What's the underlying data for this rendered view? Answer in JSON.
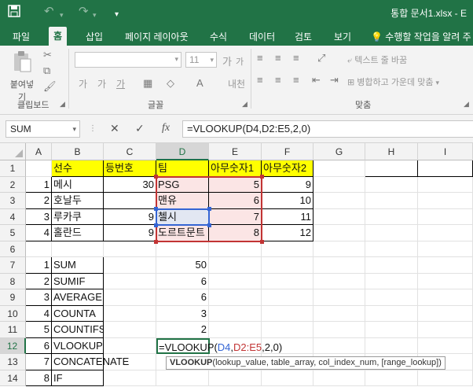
{
  "titlebar": {
    "save_icon": "save-icon",
    "undo_icon": "undo-icon",
    "redo_icon": "redo-icon",
    "qat_more_icon": "chevron-down-icon",
    "title": "통합 문서1.xlsx - E"
  },
  "tabs": [
    "파일",
    "홈",
    "삽입",
    "페이지 레이아웃",
    "수식",
    "데이터",
    "검토",
    "보기"
  ],
  "active_tab": "홈",
  "tell_me": "수행할 작업을 알려 주",
  "ribbon": {
    "clipboard": {
      "paste_label": "붙여넣기",
      "group_label": "클립보드"
    },
    "font": {
      "size_value": "11",
      "grow": "가",
      "shrink": "가",
      "group_label": "글꼴"
    },
    "alignment": {
      "wrap_text": "텍스트 줄 바꿈",
      "merge_center": "병합하고 가운데 맞춤",
      "group_label": "맞춤"
    }
  },
  "formula_bar": {
    "name_box": "SUM",
    "cancel_icon": "✕",
    "enter_icon": "✓",
    "fx_label": "fx",
    "formula": "=VLOOKUP(D4,D2:E5,2,0)"
  },
  "columns": [
    "A",
    "B",
    "C",
    "D",
    "E",
    "F",
    "G",
    "H",
    "I"
  ],
  "rows": [
    "1",
    "2",
    "3",
    "4",
    "5",
    "6",
    "7",
    "8",
    "9",
    "10",
    "11",
    "12",
    "13",
    "14"
  ],
  "table": {
    "header": {
      "b": "선수",
      "c": "등번호",
      "d": "팀",
      "e": "아무숫자1",
      "f": "아무숫자2"
    },
    "players": [
      {
        "a": "1",
        "b": "메시",
        "c": "30",
        "d": "PSG",
        "e": "5",
        "f": "9"
      },
      {
        "a": "2",
        "b": "호날두",
        "c": "",
        "d": "맨유",
        "e": "6",
        "f": "10"
      },
      {
        "a": "3",
        "b": "루카쿠",
        "c": "9",
        "d": "첼시",
        "e": "7",
        "f": "11"
      },
      {
        "a": "4",
        "b": "홀란드",
        "c": "9",
        "d": "도르트문트",
        "e": "8",
        "f": "12"
      }
    ]
  },
  "functions": [
    {
      "a": "1",
      "b": "SUM",
      "d": "50"
    },
    {
      "a": "2",
      "b": "SUMIF",
      "d": "6"
    },
    {
      "a": "3",
      "b": "AVERAGE",
      "d": "6"
    },
    {
      "a": "4",
      "b": "COUNTA",
      "d": "3"
    },
    {
      "a": "5",
      "b": "COUNTIFS",
      "d": "2"
    },
    {
      "a": "6",
      "b": "VLOOKUP",
      "d": ""
    },
    {
      "a": "7",
      "b": "CONCATENATE",
      "d": ""
    },
    {
      "a": "8",
      "b": "IF",
      "d": ""
    }
  ],
  "editing": {
    "prefix": "=VLOOKUP(",
    "ref1": "D4",
    "comma1": ",",
    "ref2": "D2:E5",
    "suffix": ",2,0)"
  },
  "tooltip": {
    "fname": "VLOOKUP",
    "args": "(lookup_value, table_array, col_index_num, [range_lookup])"
  },
  "colors": {
    "accent": "#217346",
    "header_fill": "#ffff00",
    "ref_blue": "#3465d4",
    "ref_red": "#c23434"
  }
}
